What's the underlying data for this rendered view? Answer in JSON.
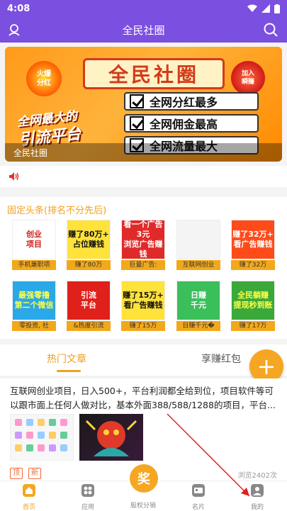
{
  "status": {
    "time": "4:08"
  },
  "header": {
    "title": "全民社圈"
  },
  "banner": {
    "title": "全民社圈",
    "hot_badge": "火爆\n分红",
    "join_badge": "加入\n瞬赚",
    "slogan_line1": "全网最大的",
    "slogan_line2": "引流平台",
    "features": [
      "全网分红最多",
      "全网佣金最高",
      "全网流量最大"
    ],
    "caption": "全民社圈"
  },
  "fixed": {
    "title": "固定头条(排名不分先后)",
    "tiles": [
      {
        "img": "创业\n项目",
        "cap": "手机兼职项",
        "bg": "#ffffff",
        "fg": "#d0201a"
      },
      {
        "img": "赚了80万+\n占位赚钱",
        "cap": "赚了80万",
        "bg": "#ffe23a",
        "fg": "#111111"
      },
      {
        "img": "看一个广告3元\n浏览广告赚钱",
        "cap": "巨量广告:",
        "bg": "#e02a2a",
        "fg": "#ffffff"
      },
      {
        "img": "",
        "cap": "互联网创业",
        "bg": "#f4f4f4",
        "fg": "#333333"
      },
      {
        "img": "赚了32万+\n看广告赚钱",
        "cap": "赚了32万",
        "bg": "#ff4a1a",
        "fg": "#ffffff"
      },
      {
        "img": "最强零撸\n第二个微信",
        "cap": "零投资, 社",
        "bg": "#2aa8e8",
        "fg": "#ffff44"
      },
      {
        "img": "引流\n平台",
        "cap": "&热度引流",
        "bg": "#e0201a",
        "fg": "#ffffff"
      },
      {
        "img": "赚了15万+\n看广告赚钱",
        "cap": "赚了15万",
        "bg": "#ffe23a",
        "fg": "#111111"
      },
      {
        "img": "日赚\n千元",
        "cap": "日赚千元�",
        "bg": "#3abf5a",
        "fg": "#ffffff"
      },
      {
        "img": "全民躺赚\n提现秒到账",
        "cap": "赚了17万",
        "bg": "#3aa83a",
        "fg": "#ffff44"
      }
    ]
  },
  "tabs": {
    "active": "热门文章",
    "other": "享赚红包"
  },
  "fab": "+",
  "article": {
    "text": "互联网创业项目，日入500+，平台利润都全给到位，项目软件等可以跟市面上任何人做对比，基本外面388/588/1288的项目，平台...",
    "badge_top": "顶",
    "badge_new": "新",
    "views": "浏览2402次"
  },
  "nav": {
    "items": [
      "首页",
      "应用",
      "股权分销",
      "名片",
      "我的"
    ],
    "center": "奖"
  },
  "colors": {
    "purple": "#7b4fe0",
    "orange": "#f5a623",
    "red_arrow": "#e02020"
  }
}
